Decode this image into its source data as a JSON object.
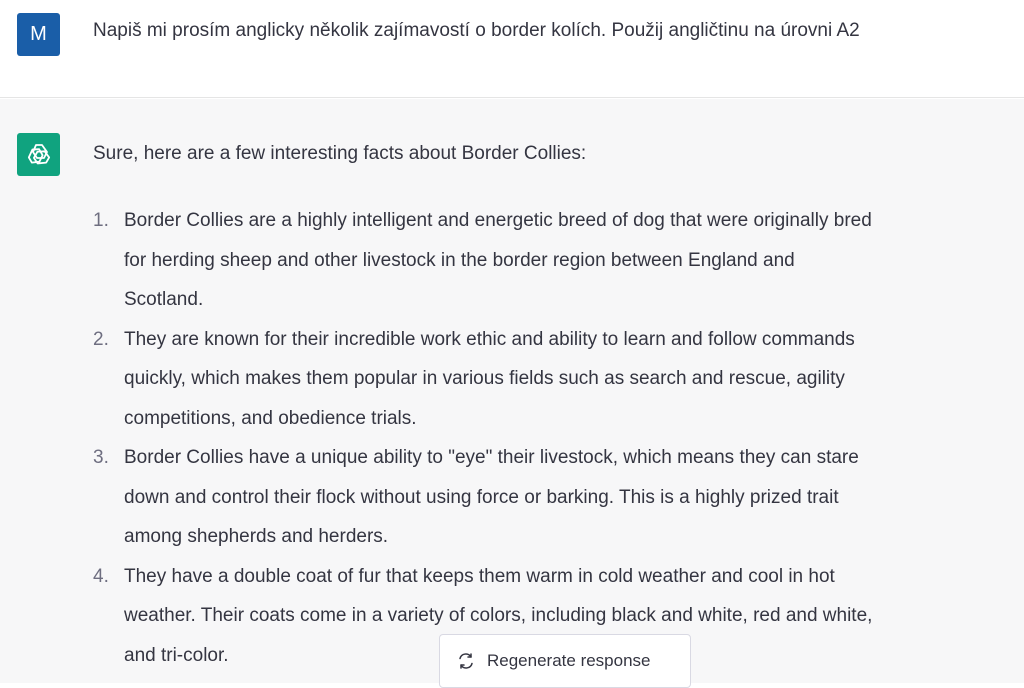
{
  "user": {
    "avatar_letter": "M",
    "message": "Napiš mi prosím anglicky několik zajímavostí o border kolích. Použij angličtinu na úrovni A2"
  },
  "assistant": {
    "intro": "Sure, here are a few interesting facts about Border Collies:",
    "facts": [
      {
        "number": "1.",
        "lines": [
          "Border Collies are a highly intelligent and energetic breed of dog that were originally bred",
          "for herding sheep and other livestock in the border region between England and",
          "Scotland."
        ]
      },
      {
        "number": "2.",
        "lines": [
          "They are known for their incredible work ethic and ability to learn and follow commands",
          "quickly, which makes them popular in various fields such as search and rescue, agility",
          "competitions, and obedience trials."
        ]
      },
      {
        "number": "3.",
        "lines": [
          "Border Collies have a unique ability to \"eye\" their livestock, which means they can stare",
          "down and control their flock without using force or barking. This is a highly prized trait",
          "among shepherds and herders."
        ]
      },
      {
        "number": "4.",
        "lines": [
          "They have a double coat of fur that keeps them warm in cold weather and cool in hot",
          "weather. Their coats come in a variety of colors, including black and white, red and white,",
          "and tri-color."
        ]
      }
    ]
  },
  "controls": {
    "regenerate_label": "Regenerate response",
    "regenerate_icon": "refresh-icon"
  },
  "colors": {
    "user_avatar": "#1a5ea8",
    "assistant_avatar": "#10a37f",
    "assistant_bg": "#f7f7f8"
  }
}
